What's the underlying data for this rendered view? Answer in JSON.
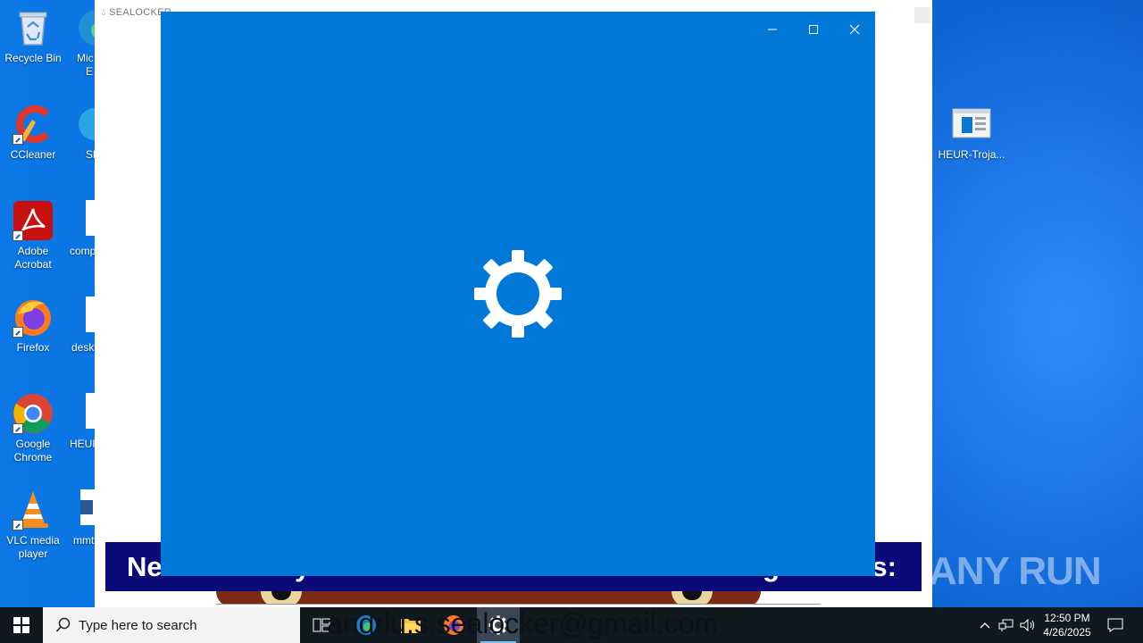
{
  "desktop": {
    "icons_left": [
      {
        "label": "Recycle Bin"
      },
      {
        "label": "CCleaner"
      },
      {
        "label": "Adobe Acrobat"
      },
      {
        "label": "Firefox"
      },
      {
        "label": "Google Chrome"
      },
      {
        "label": "VLC media player"
      }
    ],
    "icons_second_col": [
      {
        "label": "Mic"
      },
      {
        "label": "E"
      },
      {
        "label": "Sk"
      },
      {
        "label": "comp"
      },
      {
        "label": "deskt"
      },
      {
        "label": "HEUR"
      },
      {
        "label": "mmt"
      }
    ],
    "icon_right": {
      "label": "HEUR-Troja..."
    }
  },
  "ransom_window": {
    "title": "SEALOCKER",
    "banner_left": "Ne",
    "banner_mid": "y",
    "banner_mid2": "g",
    "banner_right": "s:",
    "email_text": "andrlu.s.sealocker@gmail.com"
  },
  "watermark": {
    "text": "ANY RUN"
  },
  "taskbar": {
    "search_placeholder": "Type here to search",
    "clock_time": "12:50 PM",
    "clock_date": "4/26/2025"
  },
  "colors": {
    "splash_blue": "#0078d7",
    "taskbar": "#101820",
    "banner_navy": "#0a0a78"
  }
}
